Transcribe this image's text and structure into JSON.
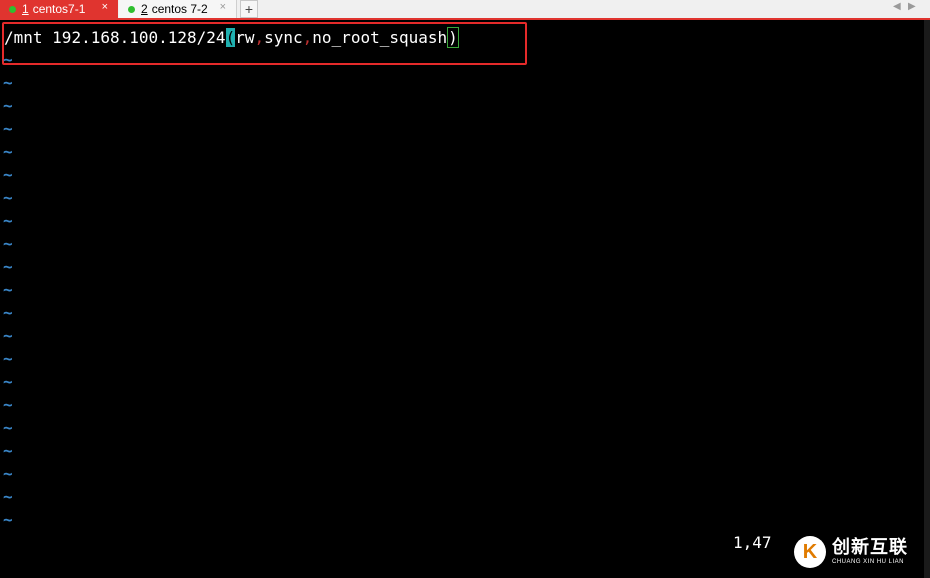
{
  "tabs": [
    {
      "number": "1",
      "label": "centos7-1",
      "active": true
    },
    {
      "number": "2",
      "label": "centos 7-2",
      "active": false
    }
  ],
  "tab_close_glyph": "×",
  "new_tab_glyph": "+",
  "nav_prev": "◀",
  "nav_next": "▶",
  "editor": {
    "line1": {
      "path": "/mnt",
      "space": " ",
      "network": "192.168.100.128/24",
      "paren_open": "(",
      "opt1": "rw",
      "sep1": ",",
      "opt2": "sync",
      "sep2": ",",
      "opt3": "no_root_squash",
      "paren_close": ")"
    },
    "empty_line_marker": "~",
    "cursor_position": "1,47"
  },
  "watermark": {
    "mark": "K",
    "title_cn": "创新互联",
    "subtitle": "CHUANG XIN HU LIAN"
  },
  "colors": {
    "accent_red": "#e0342f",
    "tilde_blue": "#3a86c8",
    "match_paren_bg": "#1fb0b0",
    "active_dot": "#2fbf2f"
  }
}
